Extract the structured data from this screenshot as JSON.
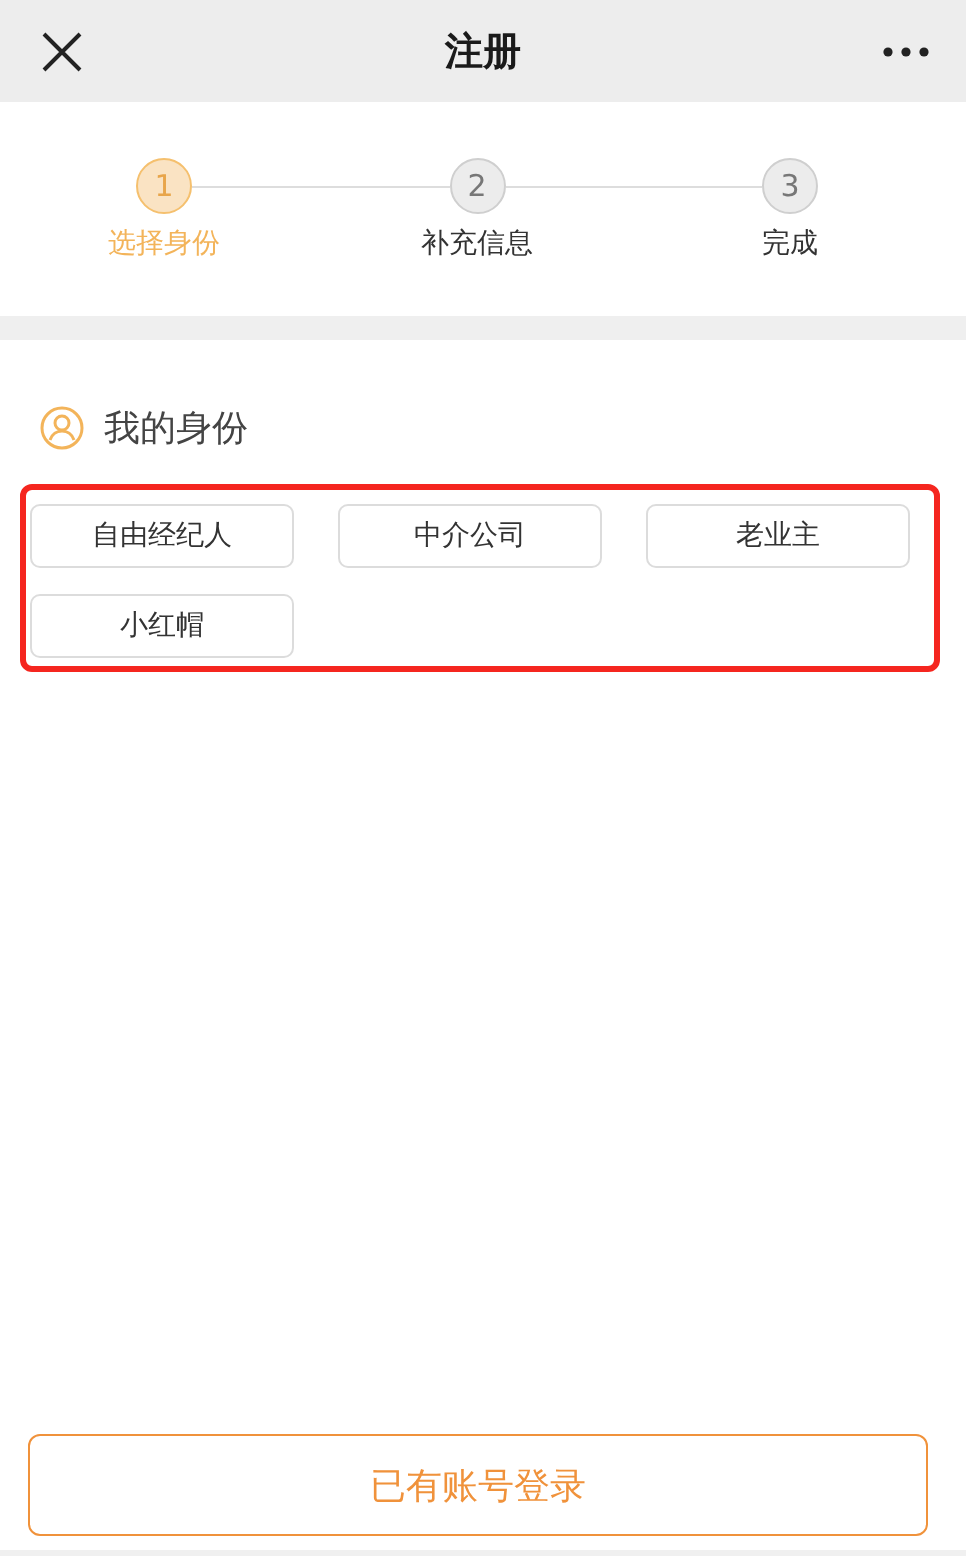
{
  "header": {
    "title": "注册"
  },
  "steps": [
    {
      "number": "1",
      "label": "选择身份",
      "selected": true
    },
    {
      "number": "2",
      "label": "补充信息",
      "selected": false
    },
    {
      "number": "3",
      "label": "完成",
      "selected": false
    }
  ],
  "section": {
    "title": "我的身份"
  },
  "identities": [
    {
      "label": "自由经纪人"
    },
    {
      "label": "中介公司"
    },
    {
      "label": "老业主"
    },
    {
      "label": "小红帽"
    }
  ],
  "login_button": "已有账号登录"
}
